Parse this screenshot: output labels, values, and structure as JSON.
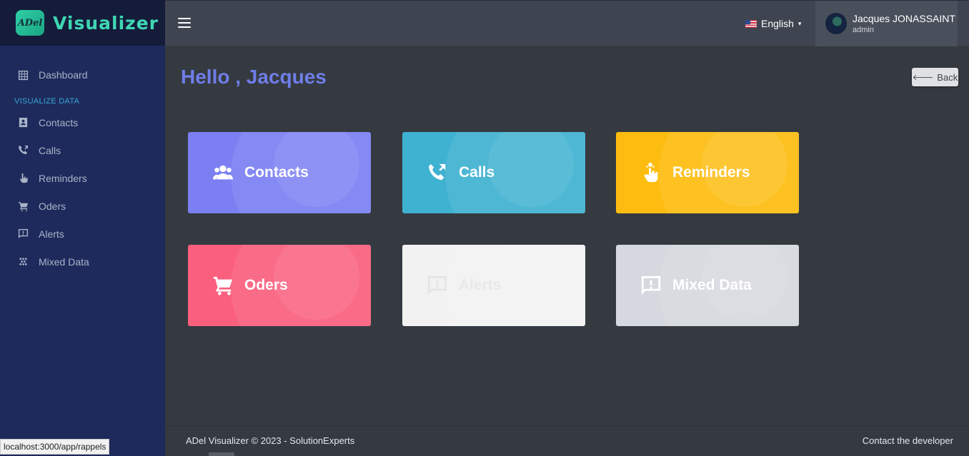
{
  "brand": {
    "logo_text": "ADel",
    "name": "Visualizer"
  },
  "sidebar": {
    "dashboard": {
      "label": "Dashboard",
      "icon": "dashboard-grid-icon"
    },
    "section_title": "VISUALIZE DATA",
    "items": [
      {
        "label": "Contacts",
        "icon": "contact-card-icon"
      },
      {
        "label": "Calls",
        "icon": "phone-icon"
      },
      {
        "label": "Reminders",
        "icon": "hand-pointer-icon"
      },
      {
        "label": "Oders",
        "icon": "cart-icon"
      },
      {
        "label": "Alerts",
        "icon": "alert-message-icon"
      },
      {
        "label": "Mixed Data",
        "icon": "dots-grid-icon"
      }
    ]
  },
  "topbar": {
    "language": "English",
    "user": {
      "name": "Jacques JONASSAINT",
      "role": "admin"
    }
  },
  "main": {
    "greeting": "Hello , Jacques",
    "back_label": "Back",
    "cards": [
      {
        "label": "Contacts",
        "icon": "users-icon",
        "color": "#7b7ff2"
      },
      {
        "label": "Calls",
        "icon": "phone-incoming-icon",
        "color": "#3fb1d1"
      },
      {
        "label": "Reminders",
        "icon": "hand-reminder-icon",
        "color": "#fdbd10"
      },
      {
        "label": "Oders",
        "icon": "cart-icon",
        "color": "#fa5f7d"
      },
      {
        "label": "Alerts",
        "icon": "alert-message-icon",
        "color": "#f2f2f2"
      },
      {
        "label": "Mixed Data",
        "icon": "alert-message-icon",
        "color": "#d5d8de"
      }
    ]
  },
  "footer": {
    "copyright": "ADel Visualizer © 2023 - SolutionExperts",
    "contact": "Contact the developer"
  },
  "statusbar": {
    "url": "localhost:3000/app/rappels"
  }
}
